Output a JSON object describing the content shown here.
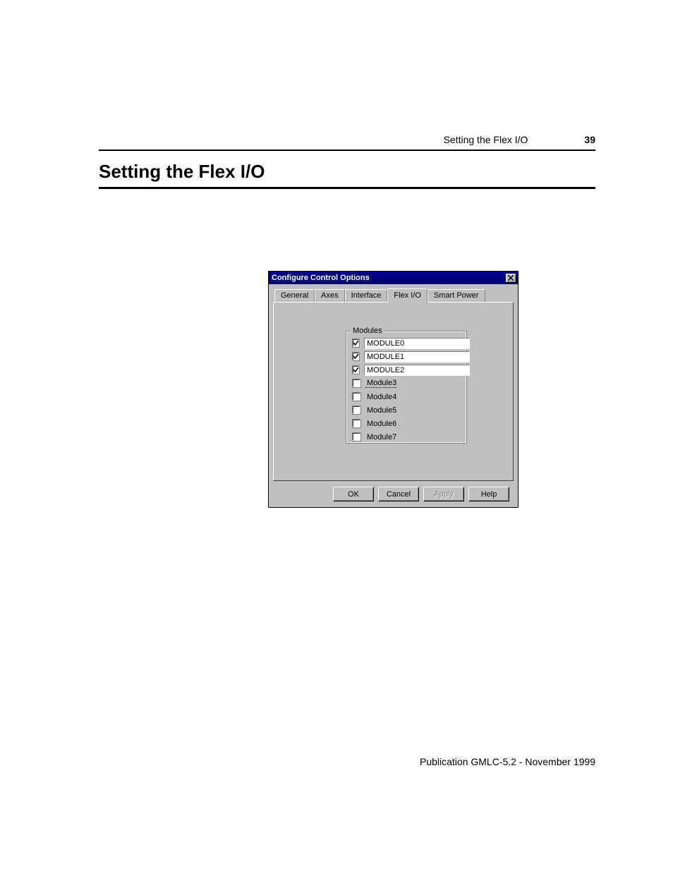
{
  "page": {
    "running_header_text": "Setting the Flex I/O",
    "page_number": "39",
    "section_title": "Setting the Flex I/O",
    "footer": "Publication GMLC-5.2 - November 1999"
  },
  "dialog": {
    "title": "Configure Control Options",
    "tabs": [
      "General",
      "Axes",
      "Interface",
      "Flex I/O",
      "Smart Power"
    ],
    "active_tab_index": 3,
    "groupbox_label": "Modules",
    "modules": [
      {
        "checked": true,
        "editable": true,
        "value": "MODULE0",
        "focused": false
      },
      {
        "checked": true,
        "editable": true,
        "value": "MODULE1",
        "focused": false
      },
      {
        "checked": true,
        "editable": true,
        "value": "MODULE2",
        "focused": false
      },
      {
        "checked": false,
        "editable": false,
        "value": "Module3",
        "focused": true
      },
      {
        "checked": false,
        "editable": false,
        "value": "Module4",
        "focused": false
      },
      {
        "checked": false,
        "editable": false,
        "value": "Module5",
        "focused": false
      },
      {
        "checked": false,
        "editable": false,
        "value": "Module6",
        "focused": false
      },
      {
        "checked": false,
        "editable": false,
        "value": "Module7",
        "focused": false
      }
    ],
    "buttons": {
      "ok": {
        "label": "OK",
        "enabled": true
      },
      "cancel": {
        "label": "Cancel",
        "enabled": true
      },
      "apply": {
        "label": "Apply",
        "enabled": false
      },
      "help": {
        "label": "Help",
        "enabled": true
      }
    }
  }
}
